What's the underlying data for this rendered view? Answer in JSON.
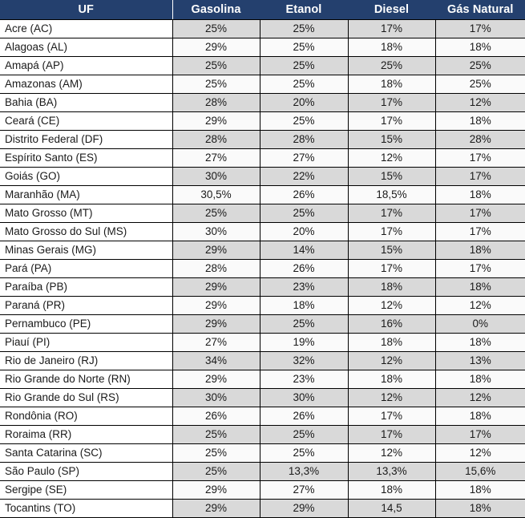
{
  "table": {
    "name": "aliquotas-combustiveis-por-uf",
    "header_bg": "#24406e",
    "header_text_color": "#ffffff",
    "shaded_row_bg": "#d9d9d9",
    "plain_row_bg": "#fafafa",
    "uf_cell_bg": "#ffffff",
    "grid_color": "#000000",
    "columns": [
      {
        "key": "uf",
        "label": "UF"
      },
      {
        "key": "gasolina",
        "label": "Gasolina"
      },
      {
        "key": "etanol",
        "label": "Etanol"
      },
      {
        "key": "diesel",
        "label": "Diesel"
      },
      {
        "key": "gas_natural",
        "label": "Gás Natural"
      }
    ],
    "rows": [
      {
        "uf": "Acre (AC)",
        "gasolina": "25%",
        "etanol": "25%",
        "diesel": "17%",
        "gas_natural": "17%"
      },
      {
        "uf": "Alagoas (AL)",
        "gasolina": "29%",
        "etanol": "25%",
        "diesel": "18%",
        "gas_natural": "18%"
      },
      {
        "uf": "Amapá (AP)",
        "gasolina": "25%",
        "etanol": "25%",
        "diesel": "25%",
        "gas_natural": "25%"
      },
      {
        "uf": "Amazonas (AM)",
        "gasolina": "25%",
        "etanol": "25%",
        "diesel": "18%",
        "gas_natural": "25%"
      },
      {
        "uf": "Bahia (BA)",
        "gasolina": "28%",
        "etanol": "20%",
        "diesel": "17%",
        "gas_natural": "12%"
      },
      {
        "uf": "Ceará (CE)",
        "gasolina": "29%",
        "etanol": "25%",
        "diesel": "17%",
        "gas_natural": "18%"
      },
      {
        "uf": "Distrito Federal (DF)",
        "gasolina": "28%",
        "etanol": "28%",
        "diesel": "15%",
        "gas_natural": "28%"
      },
      {
        "uf": "Espírito Santo (ES)",
        "gasolina": "27%",
        "etanol": "27%",
        "diesel": "12%",
        "gas_natural": "17%"
      },
      {
        "uf": "Goiás (GO)",
        "gasolina": "30%",
        "etanol": "22%",
        "diesel": "15%",
        "gas_natural": "17%"
      },
      {
        "uf": "Maranhão (MA)",
        "gasolina": "30,5%",
        "etanol": "26%",
        "diesel": "18,5%",
        "gas_natural": "18%"
      },
      {
        "uf": "Mato Grosso (MT)",
        "gasolina": "25%",
        "etanol": "25%",
        "diesel": "17%",
        "gas_natural": "17%"
      },
      {
        "uf": "Mato Grosso do Sul (MS)",
        "gasolina": "30%",
        "etanol": "20%",
        "diesel": "17%",
        "gas_natural": "17%"
      },
      {
        "uf": "Minas Gerais (MG)",
        "gasolina": "29%",
        "etanol": "14%",
        "diesel": "15%",
        "gas_natural": "18%"
      },
      {
        "uf": "Pará (PA)",
        "gasolina": "28%",
        "etanol": "26%",
        "diesel": "17%",
        "gas_natural": "17%"
      },
      {
        "uf": "Paraíba (PB)",
        "gasolina": "29%",
        "etanol": "23%",
        "diesel": "18%",
        "gas_natural": "18%"
      },
      {
        "uf": "Paraná (PR)",
        "gasolina": "29%",
        "etanol": "18%",
        "diesel": "12%",
        "gas_natural": "12%"
      },
      {
        "uf": "Pernambuco (PE)",
        "gasolina": "29%",
        "etanol": "25%",
        "diesel": "16%",
        "gas_natural": "0%"
      },
      {
        "uf": "Piauí (PI)",
        "gasolina": "27%",
        "etanol": "19%",
        "diesel": "18%",
        "gas_natural": "18%"
      },
      {
        "uf": "Rio de Janeiro (RJ)",
        "gasolina": "34%",
        "etanol": "32%",
        "diesel": "12%",
        "gas_natural": "13%"
      },
      {
        "uf": "Rio Grande do Norte (RN)",
        "gasolina": "29%",
        "etanol": "23%",
        "diesel": "18%",
        "gas_natural": "18%"
      },
      {
        "uf": "Rio Grande do Sul (RS)",
        "gasolina": "30%",
        "etanol": "30%",
        "diesel": "12%",
        "gas_natural": "12%"
      },
      {
        "uf": "Rondônia (RO)",
        "gasolina": "26%",
        "etanol": "26%",
        "diesel": "17%",
        "gas_natural": "18%"
      },
      {
        "uf": "Roraima (RR)",
        "gasolina": "25%",
        "etanol": "25%",
        "diesel": "17%",
        "gas_natural": "17%"
      },
      {
        "uf": "Santa Catarina (SC)",
        "gasolina": "25%",
        "etanol": "25%",
        "diesel": "12%",
        "gas_natural": "12%"
      },
      {
        "uf": "São Paulo (SP)",
        "gasolina": "25%",
        "etanol": "13,3%",
        "diesel": "13,3%",
        "gas_natural": "15,6%"
      },
      {
        "uf": "Sergipe (SE)",
        "gasolina": "29%",
        "etanol": "27%",
        "diesel": "18%",
        "gas_natural": "18%"
      },
      {
        "uf": "Tocantins (TO)",
        "gasolina": "29%",
        "etanol": "29%",
        "diesel": "14,5",
        "gas_natural": "18%"
      }
    ]
  }
}
